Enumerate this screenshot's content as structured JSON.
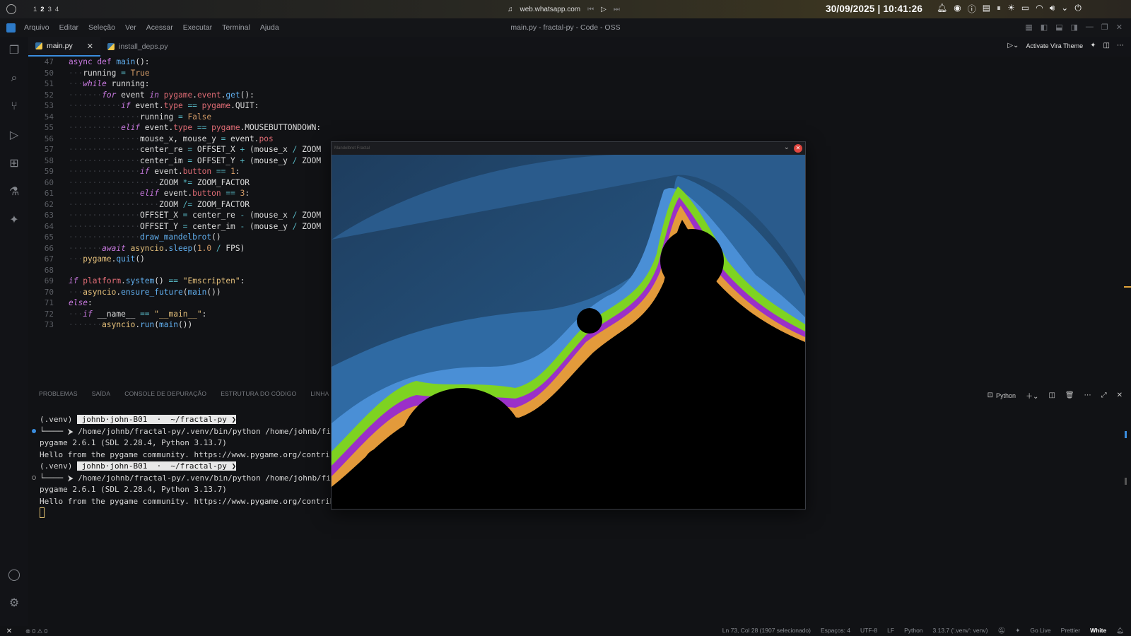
{
  "sysbar": {
    "workspaces": [
      "1",
      "2",
      "3",
      "4"
    ],
    "active_workspace": "2",
    "media_title": "web.whatsapp.com",
    "datetime": "30/09/2025 | 10:41:26"
  },
  "menubar": {
    "items": [
      "Arquivo",
      "Editar",
      "Seleção",
      "Ver",
      "Acessar",
      "Executar",
      "Terminal",
      "Ajuda"
    ],
    "title": "main.py - fractal-py - Code - OSS"
  },
  "tabs": [
    {
      "label": "main.py",
      "active": true
    },
    {
      "label": "install_deps.py",
      "active": false
    }
  ],
  "tab_actions": {
    "theme_label": "Activate Vira Theme"
  },
  "editor": {
    "line_numbers": [
      "47",
      "50",
      "51",
      "52",
      "53",
      "54",
      "55",
      "56",
      "57",
      "58",
      "59",
      "60",
      "61",
      "62",
      "63",
      "64",
      "65",
      "66",
      "67",
      "68",
      "69",
      "70",
      "71",
      "72",
      "73"
    ]
  },
  "panel": {
    "tabs": [
      "PROBLEMAS",
      "SAÍDA",
      "CONSOLE DE DEPURAÇÃO",
      "ESTRUTURA DO CÓDIGO",
      "LINHA DO TEMPO"
    ],
    "shell_label": "Python",
    "terminal": [
      {
        "prefix": "(.venv) ",
        "prompt": " johnb·john-B01  ·  ~/fractal-py ❯"
      },
      {
        "text": "└──── ⮞ /home/johnb/fractal-py/.venv/bin/python /home/johnb/fi"
      },
      {
        "text": "pygame 2.6.1 (SDL 2.28.4, Python 3.13.7)"
      },
      {
        "text": "Hello from the pygame community. https://www.pygame.org/contri"
      },
      {
        "prefix": "(.venv) ",
        "prompt": " johnb·john-B01  ·  ~/fractal-py ❯"
      },
      {
        "text": "└──── ⮞ /home/johnb/fractal-py/.venv/bin/python /home/johnb/fi"
      },
      {
        "text": "pygame 2.6.1 (SDL 2.28.4, Python 3.13.7)"
      },
      {
        "text": "Hello from the pygame community. https://www.pygame.org/contribute.html"
      }
    ]
  },
  "status": {
    "errors": "0",
    "warnings": "0",
    "position": "Ln 73, Col 28 (1907 selecionado)",
    "spaces": "Espaços: 4",
    "encoding": "UTF-8",
    "eol": "LF",
    "language": "Python",
    "interpreter": "3.13.7 ('.venv': venv)",
    "golive": "Go Live",
    "prettier": "Prettier",
    "theme": "White"
  },
  "pygame_window": {
    "title": "Mandelbrot Fractal"
  },
  "colors": {
    "accent": "#3a8dde",
    "close": "#e0463f",
    "fractal_green": "#7ed321",
    "fractal_purple": "#9b30c8"
  }
}
